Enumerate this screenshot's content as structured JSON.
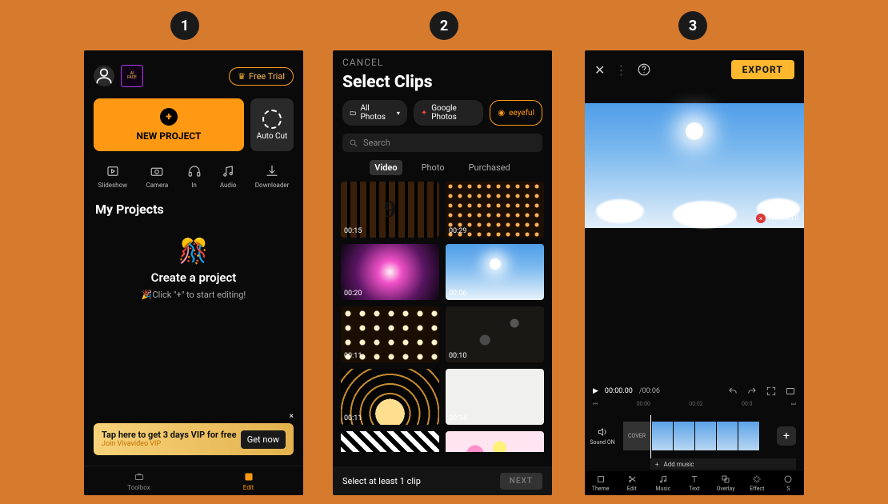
{
  "badges": [
    "1",
    "2",
    "3"
  ],
  "screen1": {
    "free_trial": "Free Trial",
    "new_project": "NEW PROJECT",
    "auto_cut": "Auto Cut",
    "tools": [
      "Slideshow",
      "Camera",
      "In",
      "Audio",
      "Downloader"
    ],
    "my_projects": "My Projects",
    "empty_title": "Create a project",
    "empty_sub": "🎉Click \"+\" to start editing!",
    "vip_title": "Tap here to get 3 days VIP for free",
    "vip_join_prefix": "Join ",
    "vip_join_brand": "Vivavideo VIP",
    "vip_get": "Get now",
    "nav": {
      "toolbox": "Toolbox",
      "edit": "Edit"
    }
  },
  "screen2": {
    "cancel": "CANCEL",
    "title": "Select Clips",
    "pill_all": "All Photos",
    "pill_google": "Google Photos",
    "pill_brand": "eeyeful",
    "search": "Search",
    "tabs": {
      "video": "Video",
      "photo": "Photo",
      "purchased": "Purchased"
    },
    "durations": [
      "00:15",
      "00:29",
      "00:20",
      "00:06",
      "00:11",
      "00:10",
      "00:11",
      "00:14",
      "",
      ""
    ],
    "hint": "Select at least 1 clip",
    "next": "NEXT"
  },
  "screen3": {
    "export": "EXPORT",
    "watermark": "VIVAVIDEO",
    "time_current": "00:00.00",
    "time_total": "/00:06",
    "ruler": [
      "00:00",
      "00:02",
      "00:0"
    ],
    "sound_on": "Sound ON",
    "cover": "COVER",
    "add_music": "Add music",
    "tools": [
      "Theme",
      "Edit",
      "Music",
      "Text",
      "Overlay",
      "Effect",
      "S"
    ]
  }
}
